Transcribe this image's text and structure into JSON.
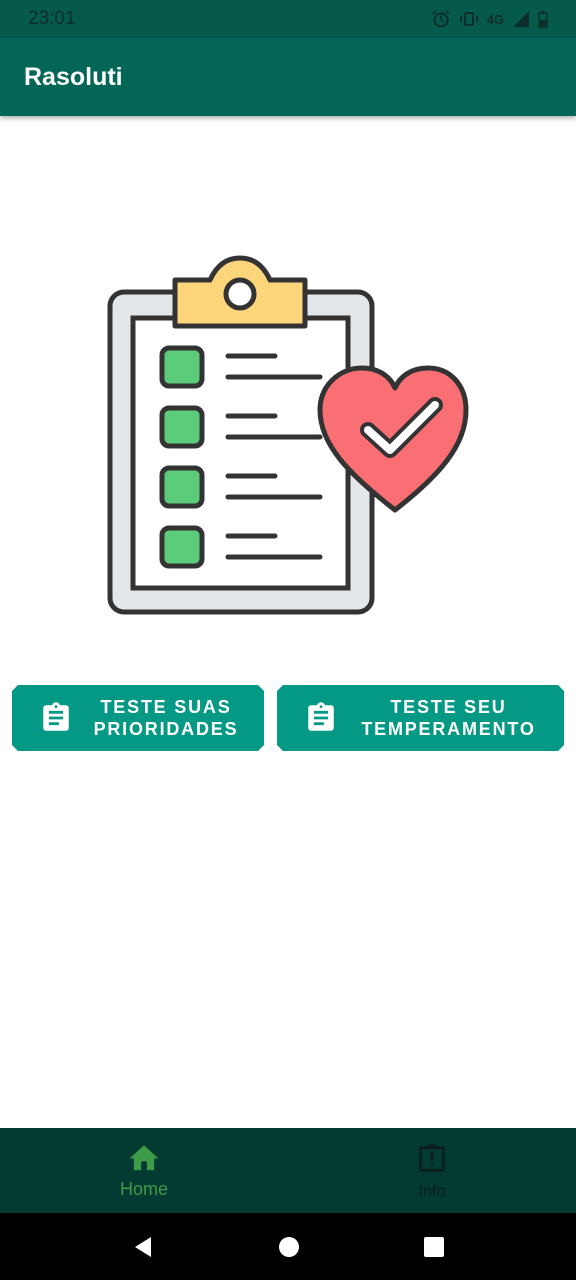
{
  "status_bar": {
    "time": "23:01",
    "network": "4G"
  },
  "app_bar": {
    "title": "Rasoluti"
  },
  "buttons": [
    {
      "label": "TESTE SUAS\nPRIORIDADES",
      "icon": "clipboard-icon"
    },
    {
      "label": "TESTE SEU\nTEMPERAMENTO",
      "icon": "clipboard-icon"
    }
  ],
  "bottom_nav": [
    {
      "label": "Home",
      "icon": "home-icon",
      "active": true
    },
    {
      "label": "Info",
      "icon": "info-clipboard-icon",
      "active": false
    }
  ],
  "colors": {
    "primary": "#036656",
    "status": "#055a4c",
    "button": "#049985",
    "nav_bg": "#033b32",
    "nav_active": "#3e9b48"
  }
}
